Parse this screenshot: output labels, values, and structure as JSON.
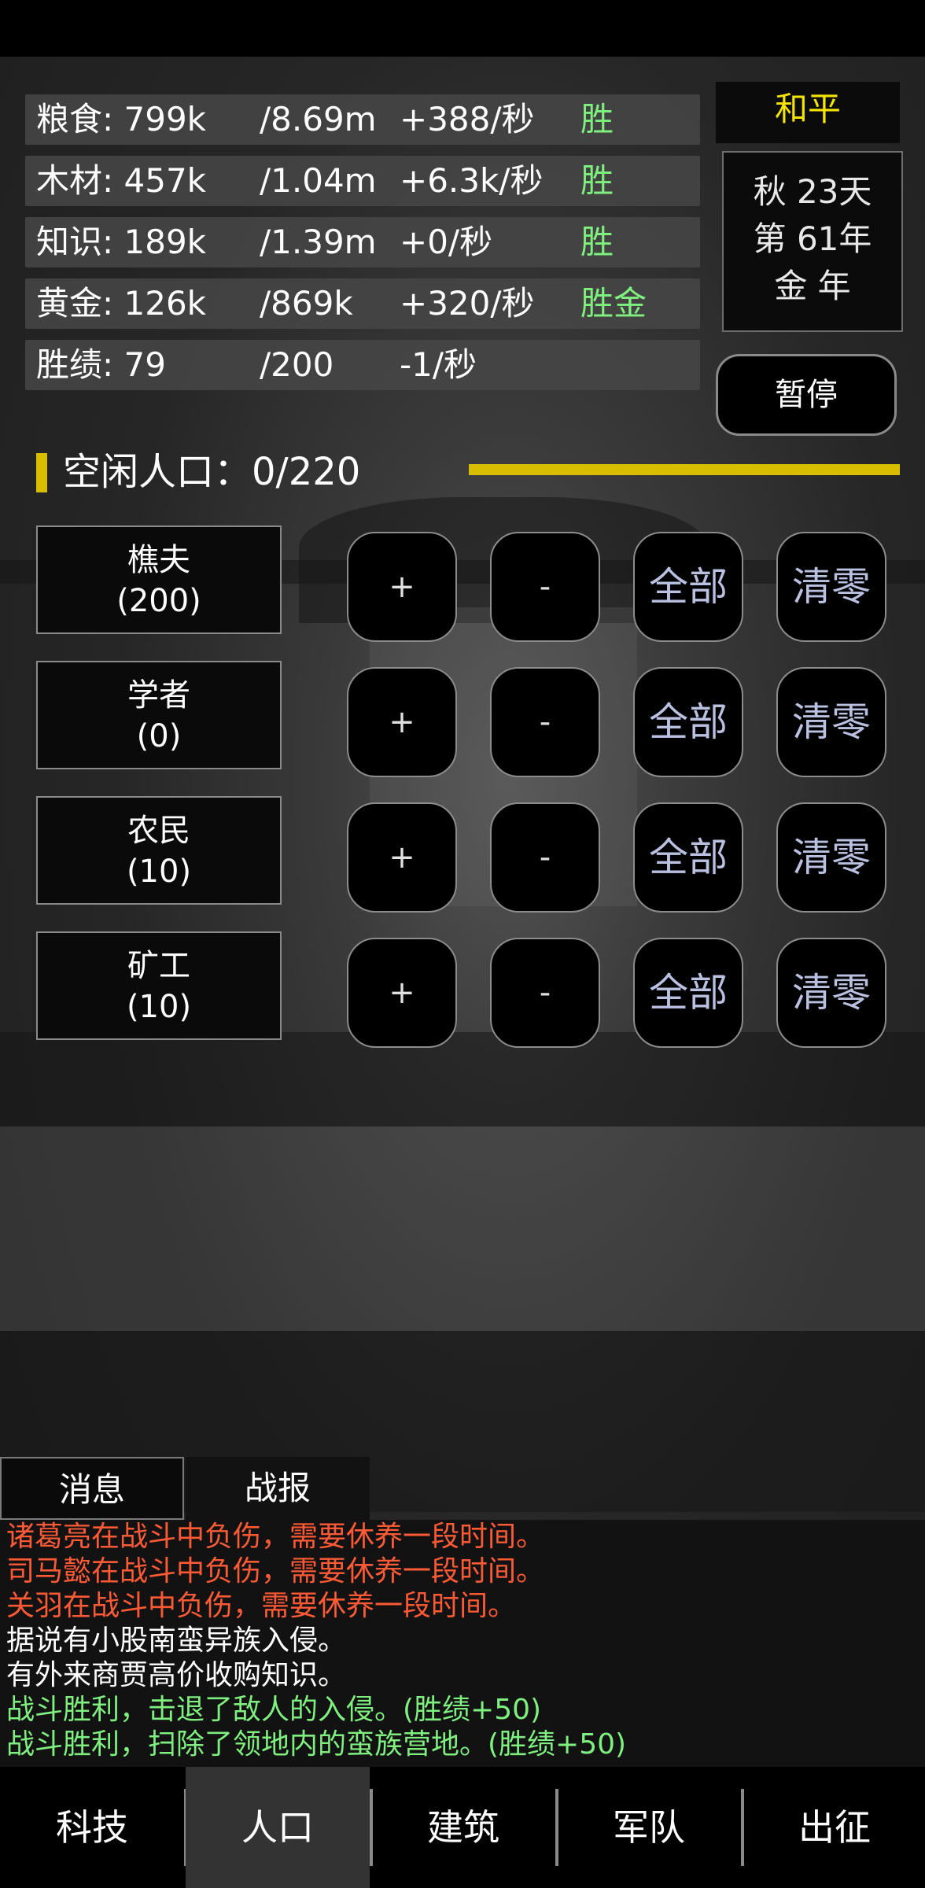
{
  "resources": [
    {
      "name": "粮食: 799k",
      "cap": "/8.69m",
      "rate": "+388/秒",
      "status": "胜"
    },
    {
      "name": "木材: 457k",
      "cap": "/1.04m",
      "rate": "+6.3k/秒",
      "status": "胜"
    },
    {
      "name": "知识: 189k",
      "cap": "/1.39m",
      "rate": "+0/秒",
      "status": "胜"
    },
    {
      "name": "黄金: 126k",
      "cap": "/869k",
      "rate": "+320/秒",
      "status": "胜金"
    },
    {
      "name": "胜绩: 79",
      "cap": "/200",
      "rate": "-1/秒",
      "status": ""
    }
  ],
  "status_panel": {
    "peace": "和平",
    "date_line1": "秋 23天",
    "date_line2": "第 61年",
    "date_line3": "金 年",
    "pause_label": "暂停"
  },
  "idle": {
    "label": "空闲人口：0/220",
    "fill_fraction": 1.0,
    "accent_color": "#d9bd00"
  },
  "roles": [
    {
      "name": "樵夫",
      "count": "(200)"
    },
    {
      "name": "学者",
      "count": "(0)"
    },
    {
      "name": "农民",
      "count": "(10)"
    },
    {
      "name": "矿工",
      "count": "(10)"
    }
  ],
  "role_buttons": {
    "plus": "+",
    "minus": "-",
    "all": "全部",
    "clear": "清零"
  },
  "log_tabs": [
    "消息",
    "战报"
  ],
  "log": [
    {
      "text": "诸葛亮在战斗中负伤，需要休养一段时间。",
      "color": "#ff5a36"
    },
    {
      "text": "司马懿在战斗中负伤，需要休养一段时间。",
      "color": "#ff5a36"
    },
    {
      "text": "关羽在战斗中负伤，需要休养一段时间。",
      "color": "#ff5a36"
    },
    {
      "text": "据说有小股南蛮异族入侵。",
      "color": "#ffffff"
    },
    {
      "text": "有外来商贾高价收购知识。",
      "color": "#ffffff"
    },
    {
      "text": "战斗胜利，击退了敌人的入侵。(胜绩+50)",
      "color": "#7ff07f"
    },
    {
      "text": "战斗胜利，扫除了领地内的蛮族营地。(胜绩+50)",
      "color": "#7ff07f"
    }
  ],
  "nav": [
    "科技",
    "人口",
    "建筑",
    "军队",
    "出征"
  ],
  "nav_selected": "人口",
  "colors": {
    "win_green": "#7ff07f",
    "peace_yellow": "#f5e400",
    "alert_red": "#ff5a36"
  }
}
